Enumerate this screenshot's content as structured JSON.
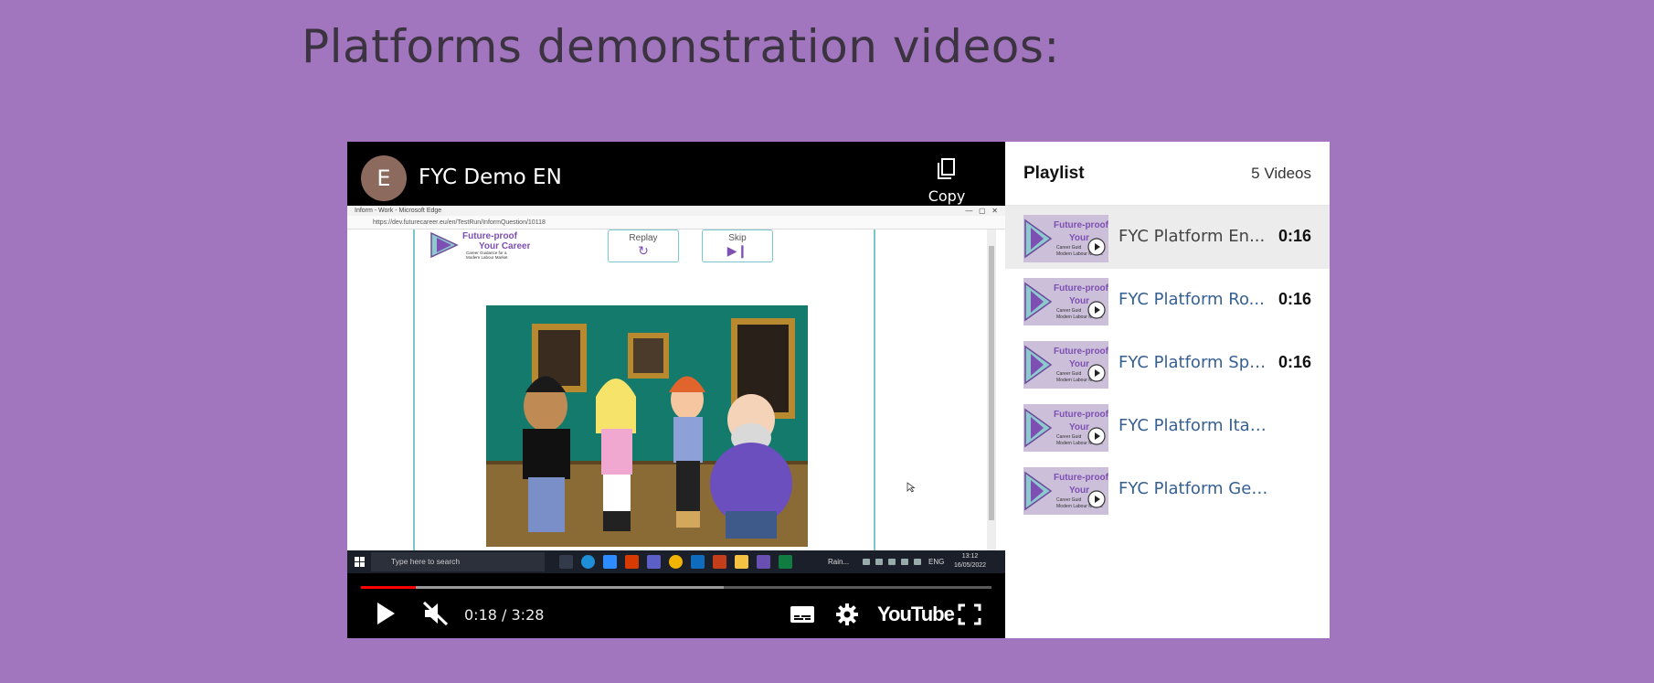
{
  "page": {
    "title": "Platforms demonstration videos:"
  },
  "player": {
    "avatar_letter": "E",
    "video_title": "FYC Demo EN",
    "copy_link_label": "Copy link",
    "time_display": "0:18 / 3:28",
    "progress_fraction": 0.0865,
    "buffered_fraction": 0.575,
    "brand": "YouTube",
    "colors": {
      "progress": "#ff0000",
      "background": "#000000"
    }
  },
  "screen": {
    "browser_title": "Inform - Work - Microsoft Edge",
    "url": "https://dev.futurecareer.eu/en/TestRun/InformQuestion/10118",
    "logo_line1": "Future-proof",
    "logo_line2": "Your Career",
    "logo_tagline": "Career Guidance for a Modern Labour Market",
    "replay_label": "Replay",
    "skip_label": "Skip",
    "taskbar": {
      "search_placeholder": "Type here to search",
      "weather": "Rain...",
      "lang": "ENG",
      "time": "13:12",
      "date": "16/05/2022"
    }
  },
  "playlist": {
    "title": "Playlist",
    "count": "5 Videos",
    "items": [
      {
        "title": "FYC Platform En...",
        "duration": "0:16"
      },
      {
        "title": "FYC Platform Ro...",
        "duration": "0:16"
      },
      {
        "title": "FYC Platform Spa...",
        "duration": "0:16"
      },
      {
        "title": "FYC Platform Italian",
        "duration": ""
      },
      {
        "title": "FYC Platform German",
        "duration": ""
      }
    ]
  }
}
